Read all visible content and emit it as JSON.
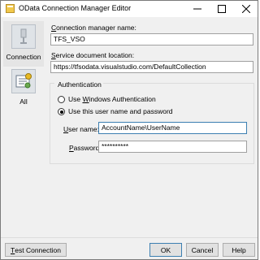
{
  "window": {
    "title": "OData Connection Manager Editor"
  },
  "sidebar": {
    "items": [
      {
        "label": "Connection",
        "icon": "connection-icon",
        "selected": true
      },
      {
        "label": "All",
        "icon": "properties-icon",
        "selected": false
      }
    ]
  },
  "form": {
    "connection_name": {
      "label_prefix": "C",
      "label_rest": "onnection manager name:",
      "value": "TFS_VSO"
    },
    "service_location": {
      "label_prefix": "S",
      "label_rest": "ervice document location:",
      "value": "https://tfsodata.visualstudio.com/DefaultCollection"
    },
    "authentication": {
      "title": "Authentication",
      "windows_auth": {
        "label_pre": "Use ",
        "label_u": "W",
        "label_post": "indows Authentication",
        "checked": false
      },
      "user_pass": {
        "label": "Use this user name and password",
        "checked": true
      },
      "username": {
        "label_u": "U",
        "label_rest": "ser name:",
        "value": "AccountName\\UserName"
      },
      "password": {
        "label_u": "P",
        "label_rest": "assword:",
        "value": "**********"
      }
    }
  },
  "buttons": {
    "test_u": "T",
    "test_rest": "est Connection",
    "ok": "OK",
    "cancel": "Cancel",
    "help": "Help"
  }
}
